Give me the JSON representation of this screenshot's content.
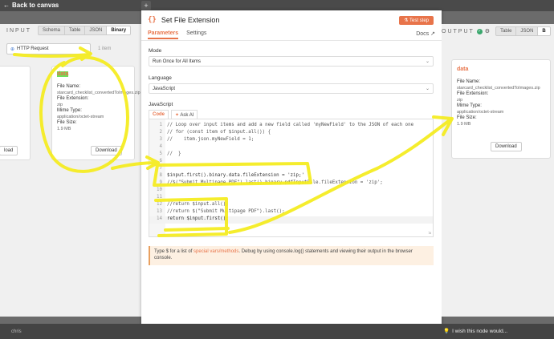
{
  "topbar": {
    "back_label": "Back to canvas",
    "plus": "+"
  },
  "input": {
    "title": "INPUT",
    "tabs": [
      "Schema",
      "Table",
      "JSON",
      "Binary"
    ],
    "active_tab": "Binary",
    "node": "HTTP Request",
    "items": "1 item",
    "card": {
      "title": "data",
      "file_name_label": "File Name:",
      "file_name": "starcard_checklist_convertedToImages.zip",
      "file_ext_label": "File Extension:",
      "file_ext": "zip",
      "mime_label": "Mime Type:",
      "mime": "application/octet-stream",
      "size_label": "File Size:",
      "size": "1.9 MB",
      "download": "Download",
      "left_download": "load"
    }
  },
  "modal": {
    "title": "Set File Extension",
    "test_step": "Test step",
    "tabs": [
      "Parameters",
      "Settings"
    ],
    "docs": "Docs",
    "mode_label": "Mode",
    "mode_value": "Run Once for All Items",
    "language_label": "Language",
    "language_value": "JavaScript",
    "js_label": "JavaScript",
    "code_tabs": [
      "Code",
      "Ask AI"
    ],
    "code_lines": [
      "// Loop over input items and add a new field called 'myNewField' to the JSON of each one",
      "// for (const item of $input.all()) {",
      "//    item.json.myNewField = 1;",
      "",
      "//  }",
      "",
      "",
      "$input.first().binary.data.fileExtension = 'zip;'",
      "//$(\"Submit Multipage PDF\").last().binary.pdfInputFile.fileExtension = 'zip';",
      "",
      "",
      "//return $input.all();",
      "//return $(\"Submit Multipage PDF\").last();",
      "return $input.first();"
    ],
    "hint_pre": "Type $ for a list of ",
    "hint_link": "special vars/methods",
    "hint_post": ". Debug by using console.log() statements and viewing their output in the browser console."
  },
  "output": {
    "title": "OUTPUT",
    "tabs": [
      "Table",
      "JSON"
    ],
    "card": {
      "title": "data",
      "file_name_label": "File Name:",
      "file_name": "starcard_checklist_convertedToImages.zip",
      "file_ext_label": "File Extension:",
      "file_ext": "zip",
      "mime_label": "Mime Type:",
      "mime": "application/octet-stream",
      "size_label": "File Size:",
      "size": "1.9 MB",
      "download": "Download"
    }
  },
  "bottom": {
    "user": "chris",
    "wish": "I wish this node would..."
  },
  "colors": {
    "accent": "#e8744a",
    "annotation": "#f5ec1c",
    "highlight": "#6ee05a"
  }
}
